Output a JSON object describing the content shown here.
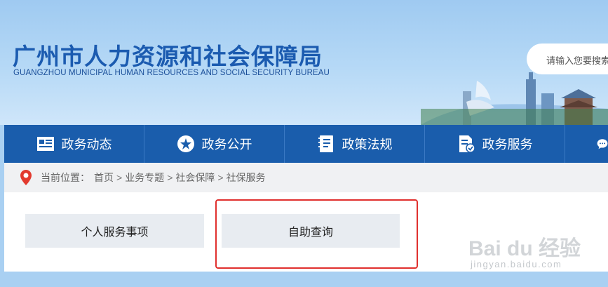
{
  "header": {
    "title_cn": "广州市人力资源和社会保障局",
    "title_en": "GUANGZHOU MUNICIPAL HUMAN RESOURCES AND SOCIAL SECURITY BUREAU",
    "search_placeholder": "请输入您要搜索"
  },
  "nav": {
    "items": [
      {
        "label": "政务动态",
        "icon": "newspaper-icon"
      },
      {
        "label": "政务公开",
        "icon": "star-icon"
      },
      {
        "label": "政策法规",
        "icon": "book-icon"
      },
      {
        "label": "政务服务",
        "icon": "service-doc-icon"
      },
      {
        "label": "",
        "icon": "chat-icon"
      }
    ]
  },
  "breadcrumb": {
    "prefix": "当前位置：",
    "items": [
      "首页",
      "业务专题",
      "社会保障",
      "社保服务"
    ],
    "separator": ">"
  },
  "services": {
    "items": [
      "个人服务事项",
      "自助查询"
    ]
  },
  "watermark": {
    "logo": "Bai du 经验",
    "url": "jingyan.baidu.com"
  },
  "colors": {
    "nav_bg": "#1a5dac",
    "title": "#1b5bb0",
    "highlight": "#e0302e",
    "header_bg": "#a9d0f2"
  }
}
